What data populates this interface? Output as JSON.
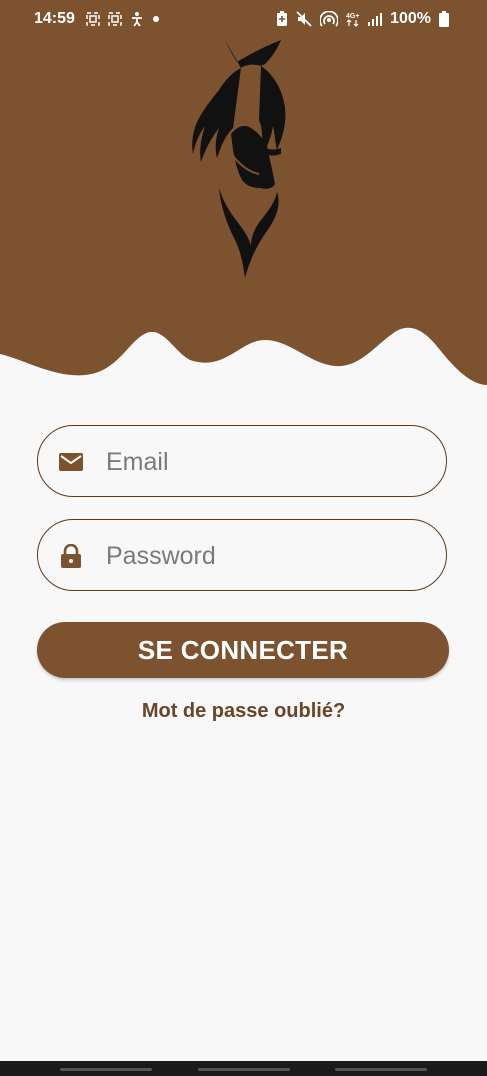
{
  "status_bar": {
    "time": "14:59",
    "battery_percent": "100%",
    "icons_left": [
      "screenshot-icon",
      "screenshot-icon",
      "accessibility-icon",
      "dot-icon"
    ],
    "icons_right": [
      "battery-saver-icon",
      "mute-icon",
      "hotspot-icon",
      "4g-icon",
      "signal-icon",
      "battery-icon"
    ]
  },
  "theme": {
    "brand_color": "#7c522f",
    "background": "#f8f8f8",
    "link_color": "#6b4426"
  },
  "logo": {
    "icon": "horse-head-icon"
  },
  "form": {
    "email": {
      "placeholder": "Email",
      "value": "",
      "icon": "envelope-icon"
    },
    "password": {
      "placeholder": "Password",
      "value": "",
      "icon": "lock-icon"
    },
    "submit_label": "SE CONNECTER",
    "forgot_label": "Mot de passe oublié?"
  }
}
